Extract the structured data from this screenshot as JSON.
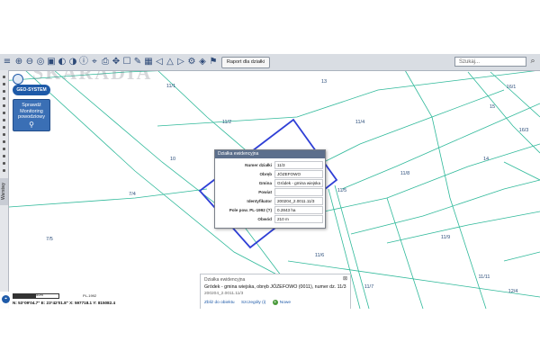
{
  "colors": {
    "parcel_lines": "#2fb99a",
    "selected_parcel": "#2f3fd6",
    "toolbar_bg": "#d9dde3",
    "popup_header": "#5c6f8c",
    "brand_blue": "#1e5aa8"
  },
  "toolbar": {
    "icons": [
      "layers-icon",
      "zoom-in-icon",
      "zoom-out-icon",
      "zoom-extent-icon",
      "zoom-window-icon",
      "back-icon",
      "forward-icon",
      "info-icon",
      "measure-icon",
      "print-icon",
      "pan-icon",
      "select-icon",
      "clear-icon",
      "filter-icon",
      "fullscreen-icon",
      "arrow-left-icon",
      "arrow-up-icon",
      "arrow-right-icon",
      "arrow-down-icon",
      "tools-icon",
      "map-icon",
      "table-icon",
      "bookmark-icon"
    ],
    "report_button_label": "Raport dla działki",
    "search_placeholder": "Szukaj..."
  },
  "branding": {
    "watermark": "SKARADIA",
    "geo_logo_text": "GEO-SYSTEM",
    "monitor_text_1": "Sprawdź",
    "monitor_text_2": "Monitoring",
    "monitor_text_3": "powodziowy",
    "rail_tab_label": "Warstwy"
  },
  "parcel_labels": [
    {
      "text": "11/1"
    },
    {
      "text": "13"
    },
    {
      "text": "16/1"
    },
    {
      "text": "15"
    },
    {
      "text": "16/3"
    },
    {
      "text": "11/2"
    },
    {
      "text": "11/4"
    },
    {
      "text": "10"
    },
    {
      "text": "14"
    },
    {
      "text": "11/8"
    },
    {
      "text": "7/4"
    },
    {
      "text": "11/5"
    },
    {
      "text": "7/5"
    },
    {
      "text": "11/6"
    },
    {
      "text": "11/9"
    },
    {
      "text": "11/7"
    },
    {
      "text": "11/11"
    },
    {
      "text": "12/4"
    }
  ],
  "popup": {
    "title": "Działka ewidencyjna",
    "rows": [
      {
        "key": "Numer działki",
        "value": "11/3"
      },
      {
        "key": "Obręb",
        "value": "JÓZEFOWO"
      },
      {
        "key": "Gmina",
        "value": "Gródek - gmina wiejska"
      },
      {
        "key": "Powiat",
        "value": ""
      },
      {
        "key": "Identyfikator",
        "value": "200204_2.0011.11/3"
      },
      {
        "key": "Pole pow. PL-1992 (?)",
        "value": "0.2843 ha"
      },
      {
        "key": "Obwód",
        "value": "210 m"
      }
    ]
  },
  "info_panel": {
    "heading": "Działka ewidencyjna",
    "close": "⊠",
    "line1": "Gródek - gmina wiejska, obręb JÓZEFOWO (0011), numer dz. 11/3",
    "line2": "200204_2.0011.11/3",
    "link1": "Zbliż do obiektu",
    "link2": "Szczegóły (i)",
    "link3": "Nowe"
  },
  "status": {
    "scale_label": "50m",
    "crs_label": "PL-1992",
    "coordinates": "N: 53°09'04.7\"  E: 23°42'01.8\"  X: 597718.1  Y: 815082.4"
  }
}
